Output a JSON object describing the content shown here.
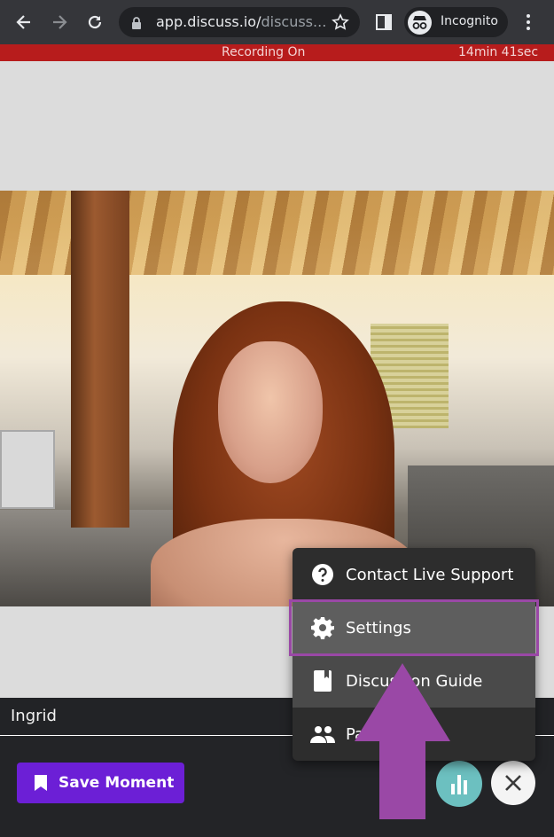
{
  "browser": {
    "url_main": "app.discuss.io/",
    "url_dim": "discuss...",
    "incognito_label": "Incognito"
  },
  "recording": {
    "status": "Recording On",
    "elapsed": "14min 41sec"
  },
  "participant": {
    "name": "Ingrid"
  },
  "menu": {
    "items": [
      {
        "label": "Contact Live Support",
        "icon": "help-circle-icon"
      },
      {
        "label": "Settings",
        "icon": "gear-icon"
      },
      {
        "label": "Discussion Guide",
        "icon": "book-icon"
      },
      {
        "label": "Participants",
        "icon": "people-icon"
      }
    ]
  },
  "toolbar": {
    "save_moment_label": "Save Moment"
  },
  "colors": {
    "recording_bar": "#b71c1c",
    "save_button": "#6c1fd6",
    "highlight": "#9a48a6",
    "poll_button": "#6cc0c0"
  }
}
